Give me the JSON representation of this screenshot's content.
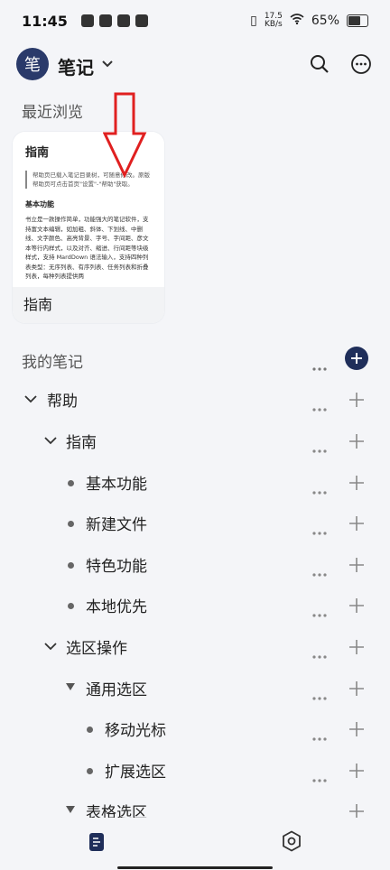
{
  "status_bar": {
    "time": "11:45",
    "speed_value": "17.5",
    "speed_unit": "KB/s",
    "battery": "65%"
  },
  "top_bar": {
    "avatar_char": "笔",
    "title": "笔记"
  },
  "recent": {
    "label": "最近浏览",
    "card": {
      "preview_title": "指南",
      "preview_quote": "帮助页已载入笔记目录树，可随意修改。原版帮助页可点击首页\"设置\"-\"帮助\"获取。",
      "preview_heading": "基本功能",
      "preview_body": "书立是一款操作简单，功能强大的笔记软件，支持富文本编辑，如加粗、斜体、下划线、中删线、文字颜色、高亮背景、字号、字间距、彦文本等行内样式，以及对齐、缩进、行间距等块级样式，支持 MardDown 语法输入，支持四种列表类型：无序列表、有序列表、任务列表和折叠列表，每种列表提供两",
      "label": "指南"
    }
  },
  "my_notes": {
    "label": "我的笔记",
    "rows": [
      {
        "label": "帮助"
      },
      {
        "label": "指南"
      },
      {
        "label": "基本功能"
      },
      {
        "label": "新建文件"
      },
      {
        "label": "特色功能"
      },
      {
        "label": "本地优先"
      },
      {
        "label": "选区操作"
      },
      {
        "label": "通用选区"
      },
      {
        "label": "移动光标"
      },
      {
        "label": "扩展选区"
      },
      {
        "label": "表格选区"
      }
    ]
  },
  "colors": {
    "accent": "#1f2e5a",
    "arrow": "#e02020"
  },
  "icons": [
    "search-icon",
    "more-icon",
    "plus-icon",
    "notes-icon",
    "settings-icon"
  ]
}
